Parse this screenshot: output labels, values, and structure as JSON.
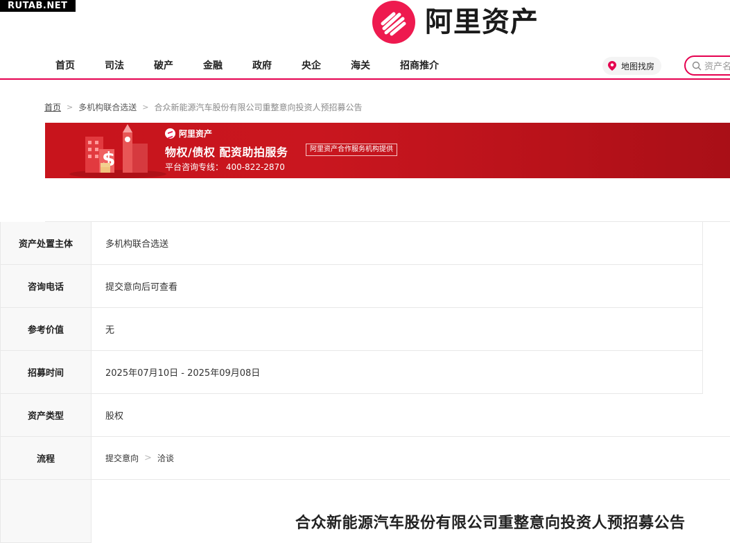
{
  "watermark": "RUTAB.NET",
  "header": {
    "logo_text": "阿里资产",
    "nav": [
      "首页",
      "司法",
      "破产",
      "金融",
      "政府",
      "央企",
      "海关",
      "招商推介"
    ],
    "map_label": "地图找房",
    "search_placeholder": "资产名"
  },
  "breadcrumb": {
    "home": "首页",
    "level2": "多机构联合选送",
    "current": "合众新能源汽车股份有限公司重整意向投资人预招募公告"
  },
  "banner": {
    "brand": "阿里资产",
    "headline": "物权/债权  配资助拍服务",
    "tag": "阿里资产合作服务机构提供",
    "hotline": "平台咨询专线： 400-822-2870"
  },
  "info": {
    "rows": [
      {
        "label": "资产处置主体",
        "value": "多机构联合选送"
      },
      {
        "label": "咨询电话",
        "value": "提交意向后可查看"
      },
      {
        "label": "参考价值",
        "value": "无"
      },
      {
        "label": "招募时间",
        "value": "2025年07月10日 - 2025年09月08日"
      },
      {
        "label": "资产类型",
        "value": "股权"
      }
    ],
    "flow_label": "流程",
    "flow_steps": [
      "提交意向",
      "洽谈"
    ]
  },
  "notice_title": "合众新能源汽车股份有限公司重整意向投资人预招募公告",
  "colors": {
    "brand": "#e5004f",
    "banner": "#c8141c",
    "label_bg": "#f8f8f8",
    "border": "#e8e8e8"
  }
}
